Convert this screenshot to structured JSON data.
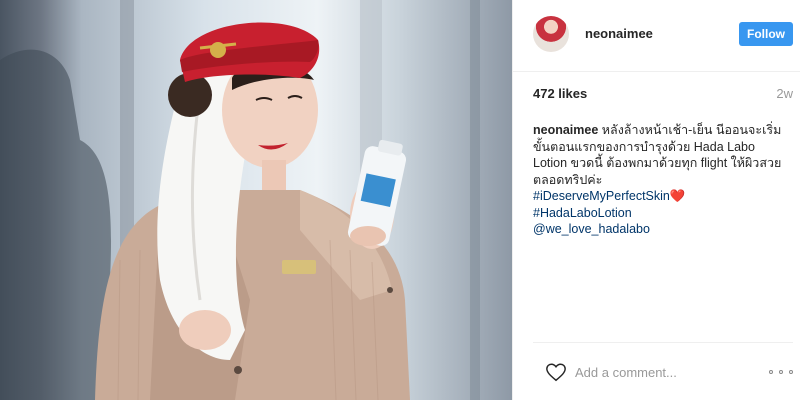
{
  "post": {
    "username": "neonaimee",
    "follow_label": "Follow",
    "likes": "472 likes",
    "time_ago": "2w",
    "caption": {
      "username": "neonaimee",
      "text": "หลังล้างหน้าเช้า-เย็น นีออนจะเริ่มขั้นตอนแรกของการบำรุงด้วย Hada Labo Lotion ขวดนี้ ต้องพกมาด้วยทุก flight ให้ผิวสวยตลอดทริปค่ะ",
      "hashtags": [
        "#iDeserveMyPerfectSkin",
        "#HadaLaboLotion"
      ],
      "heart_emoji": "❤️",
      "mention": "@we_love_hadalabo"
    },
    "comment": {
      "placeholder": "Add a comment..."
    },
    "icons": {
      "like": "heart-outline-icon",
      "more": "more-options-icon"
    },
    "colors": {
      "follow_button": "#3897f0",
      "link": "#003569",
      "hat": "#c8202f"
    }
  }
}
